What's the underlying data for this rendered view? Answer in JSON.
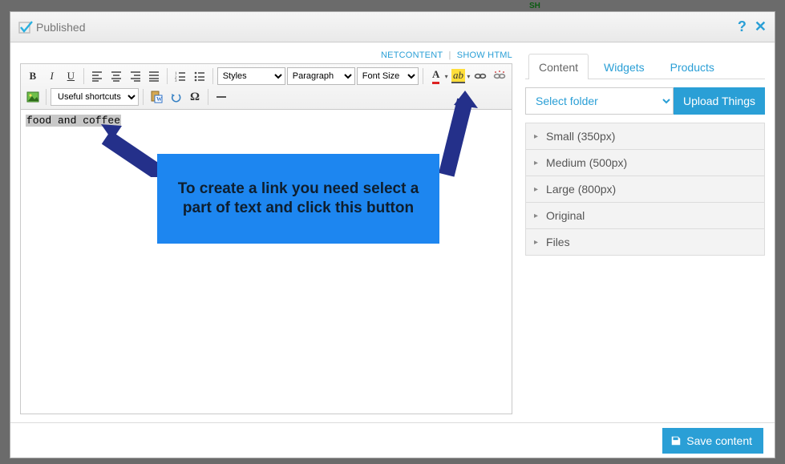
{
  "header": {
    "published_label": "Published",
    "help_icon": "?",
    "close_icon": "✕"
  },
  "editor": {
    "top_links": {
      "netcontent": "NETCONTENT",
      "show_html": "SHOW HTML"
    },
    "selects": {
      "styles": "Styles",
      "format": "Paragraph",
      "fontsize": "Font Size",
      "shortcuts": "Useful shortcuts"
    },
    "content_selected": "food and coffee"
  },
  "annotation": {
    "text": "To create a link you need select a part of text and click this button"
  },
  "sidebar": {
    "tabs": [
      "Content",
      "Widgets",
      "Products"
    ],
    "active_tab": 0,
    "folder_select": "Select folder",
    "upload_label": "Upload Things",
    "accordion": [
      "Small (350px)",
      "Medium (500px)",
      "Large (800px)",
      "Original",
      "Files"
    ]
  },
  "footer": {
    "save_label": "Save content"
  }
}
